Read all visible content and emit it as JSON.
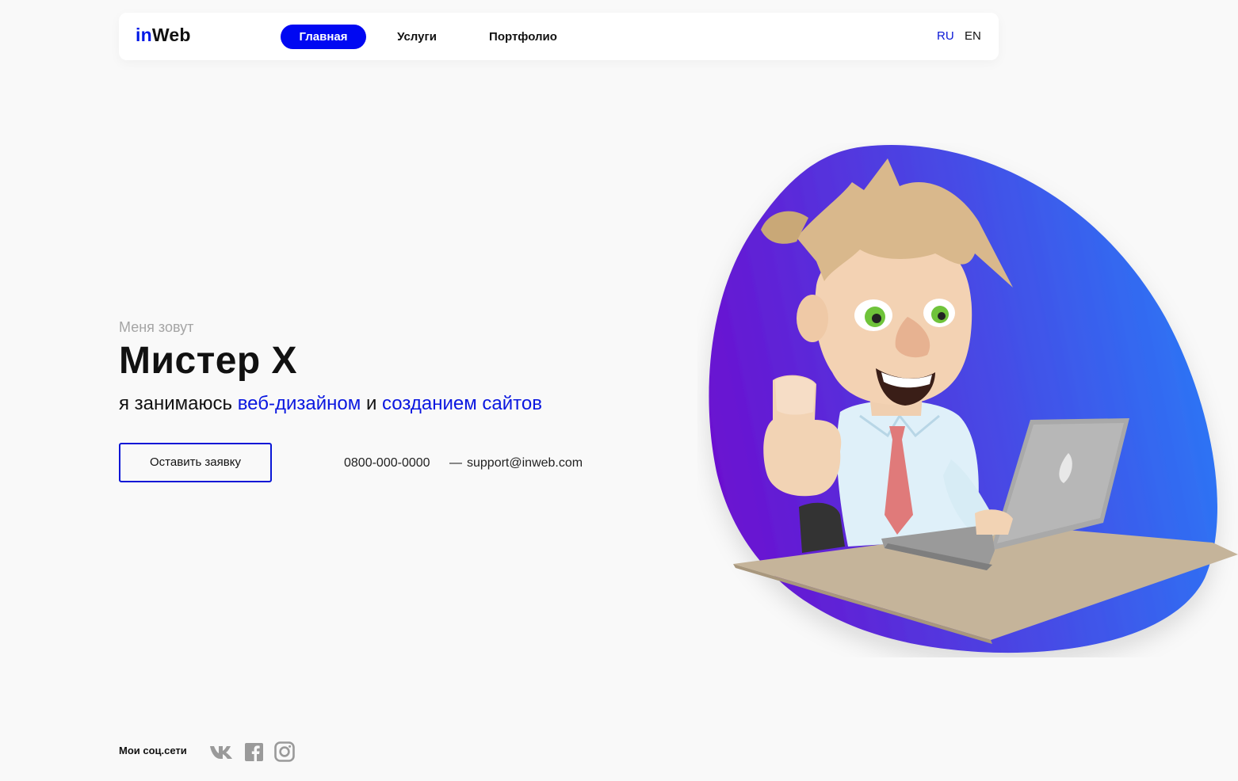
{
  "header": {
    "logo_in": "in",
    "logo_web": "Web",
    "nav": [
      {
        "label": "Главная",
        "active": true
      },
      {
        "label": "Услуги",
        "active": false
      },
      {
        "label": "Портфолио",
        "active": false
      }
    ],
    "langs": [
      {
        "label": "RU",
        "active": true
      },
      {
        "label": "EN",
        "active": false
      }
    ]
  },
  "hero": {
    "intro": "Меня зовут",
    "name": "Мистер X",
    "tagline_start": "я занимаюсь ",
    "tagline_accent1": "веб-дизайном",
    "tagline_mid": " и ",
    "tagline_accent2": "созданием сайтов",
    "cta_label": "Оставить заявку",
    "phone": "0800-000-0000",
    "separator": "—",
    "email": "support@inweb.com"
  },
  "social": {
    "label": "Мои соц.сети",
    "icons": [
      "vk-icon",
      "facebook-icon",
      "instagram-icon"
    ]
  },
  "colors": {
    "accent": "#0008f2",
    "blob_start": "#6b10d0",
    "blob_end": "#2a78f6"
  }
}
